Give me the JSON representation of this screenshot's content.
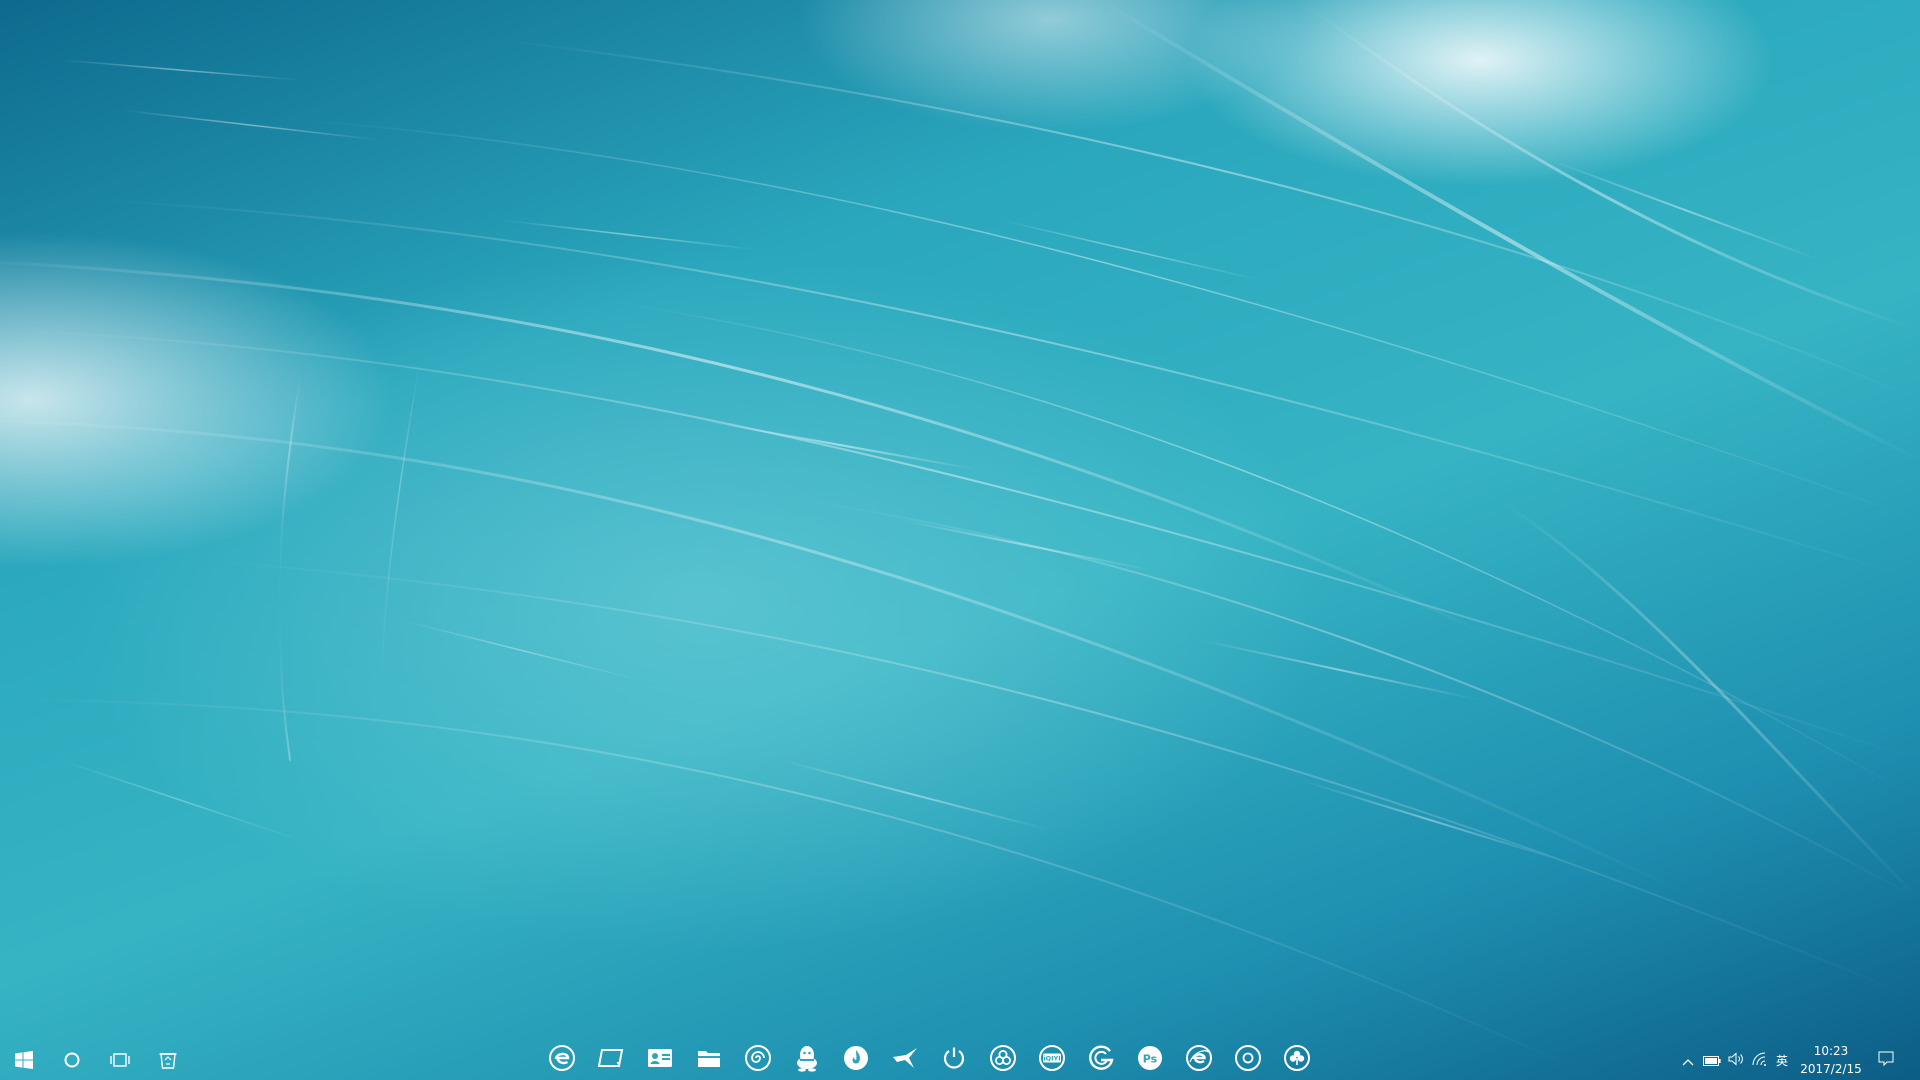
{
  "desktop": {
    "wallpaper_colors": [
      "#0e6a8e",
      "#2aa7bd",
      "#36b4c4",
      "#ffffff"
    ]
  },
  "taskbar": {
    "left_buttons": [
      {
        "icon": "windows-start-icon"
      },
      {
        "icon": "cortana-search-icon"
      },
      {
        "icon": "task-view-icon"
      },
      {
        "icon": "recycle-bin-icon"
      }
    ],
    "pinned_apps": [
      {
        "icon": "edge-browser-icon"
      },
      {
        "icon": "tablet-icon"
      },
      {
        "icon": "contact-card-icon"
      },
      {
        "icon": "file-explorer-icon"
      },
      {
        "icon": "spiral-app-icon"
      },
      {
        "icon": "qq-penguin-icon"
      },
      {
        "icon": "flame-app-icon"
      },
      {
        "icon": "bird-app-icon"
      },
      {
        "icon": "power-icon"
      },
      {
        "icon": "circles-app-icon"
      },
      {
        "icon": "iqiyi-icon"
      },
      {
        "icon": "g-app-icon"
      },
      {
        "icon": "photoshop-icon"
      },
      {
        "icon": "ie-browser-icon"
      },
      {
        "icon": "target-app-icon"
      },
      {
        "icon": "clover-app-icon"
      }
    ],
    "icon_labels": {
      "iqiyi": "iQIYI",
      "photoshop": "Ps"
    },
    "tray": {
      "chevron": "chevron-up-icon",
      "battery": "battery-icon",
      "volume": "volume-icon",
      "network": "wifi-icon",
      "ime": "英",
      "notification": "action-center-icon"
    },
    "clock": {
      "time": "10:23",
      "date": "2017/2/15"
    }
  }
}
